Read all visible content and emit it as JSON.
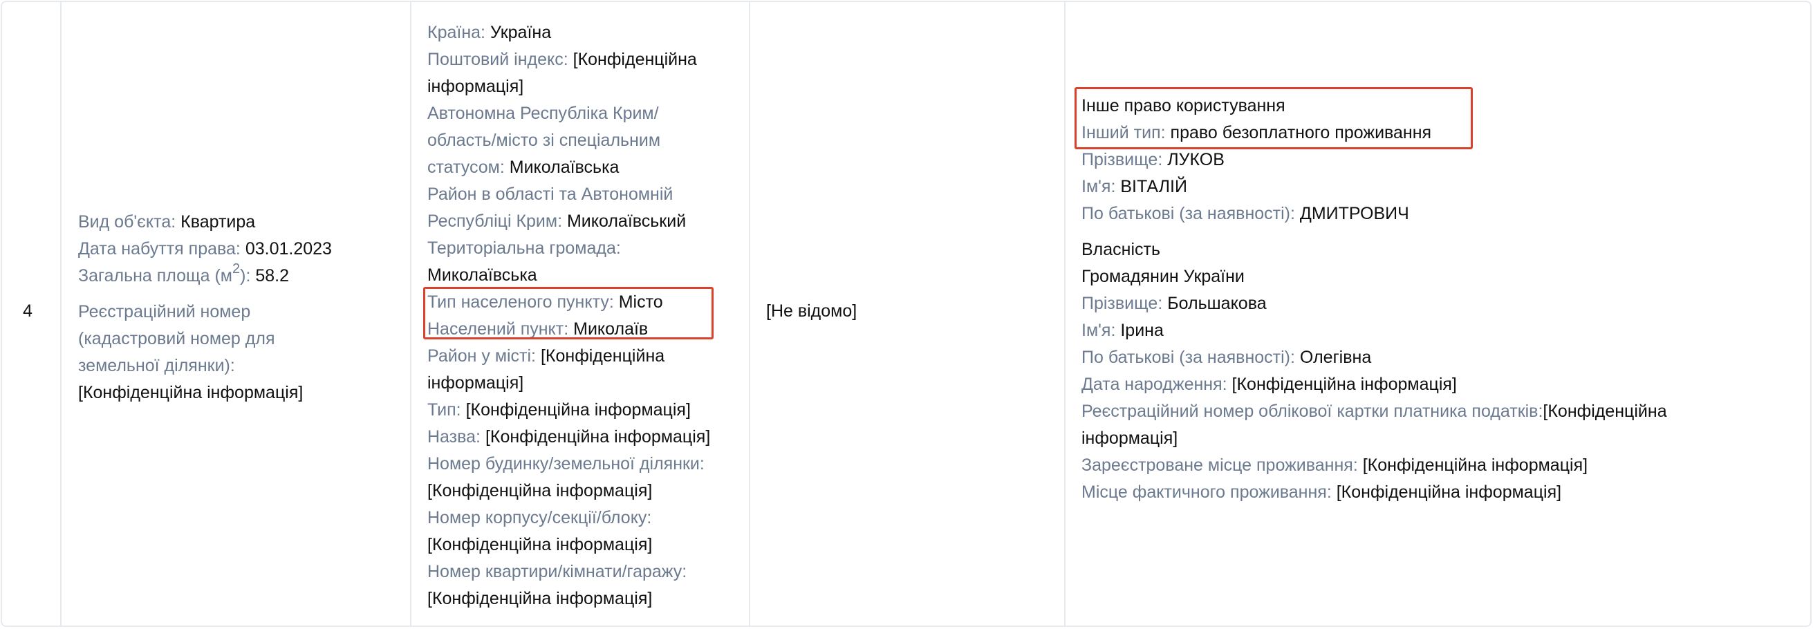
{
  "row": {
    "number": "4",
    "object": {
      "type_label": "Вид об'єкта:",
      "type_value": "Квартира",
      "date_label": "Дата набуття права:",
      "date_value": "03.01.2023",
      "area_label_pre": "Загальна площа (м",
      "area_label_sup": "2",
      "area_label_post": "):",
      "area_value": "58.2",
      "reg_label_line1": "Реєстраційний номер",
      "reg_label_line2": "(кадастровий номер для",
      "reg_label_line3": "земельної ділянки):",
      "reg_value": "[Конфіденційна інформація]"
    },
    "address": {
      "country_label": "Країна:",
      "country_value": "Україна",
      "postal_label": "Поштовий індекс:",
      "postal_value_1": "[Конфіденційна",
      "postal_value_2": "інформація]",
      "region_label_1": "Автономна Республіка Крим/",
      "region_label_2": "область/місто зі спеціальним",
      "region_label_3": "статусом:",
      "region_value": "Миколаївська",
      "district_label_1": "Район в області та Автономній",
      "district_label_2": "Республіці Крим:",
      "district_value": "Миколаївський",
      "community_label": "Територіальна громада:",
      "community_value": "Миколаївська",
      "settlement_type_label": "Тип населеного пункту:",
      "settlement_type_value": "Місто",
      "settlement_label": "Населений пункт:",
      "settlement_value": "Миколаїв",
      "city_district_label": "Район у місті:",
      "city_district_value_1": "[Конфіденційна",
      "city_district_value_2": "інформація]",
      "street_type_label": "Тип:",
      "street_type_value": "[Конфіденційна інформація]",
      "street_name_label": "Назва:",
      "street_name_value": "[Конфіденційна інформація]",
      "house_label": "Номер будинку/земельної ділянки:",
      "house_value": "[Конфіденційна інформація]",
      "building_label": "Номер корпусу/секції/блоку:",
      "building_value": "[Конфіденційна інформація]",
      "apartment_label": "Номер квартири/кімнати/гаражу:",
      "apartment_value": "[Конфіденційна інформація]"
    },
    "unknown": "[Не відомо]",
    "rights": {
      "use_title": "Інше право користування",
      "other_type_label": "Інший тип:",
      "other_type_value": "право безоплатного проживання",
      "surname_label_1": "Прізвище:",
      "surname_value_1": "ЛУКОВ",
      "name_label_1": "Ім'я:",
      "name_value_1": "ВІТАЛІЙ",
      "patronymic_label_1": "По батькові (за наявності):",
      "patronymic_value_1": "ДМИТРОВИЧ",
      "ownership_title": "Власність",
      "citizen": "Громадянин України",
      "surname_label_2": "Прізвище:",
      "surname_value_2": "Большакова",
      "name_label_2": "Ім'я:",
      "name_value_2": "Ірина",
      "patronymic_label_2": "По батькові (за наявності):",
      "patronymic_value_2": "Олегівна",
      "birth_label": "Дата народження:",
      "birth_value": "[Конфіденційна інформація]",
      "tax_label": "Реєстраційний номер облікової картки платника податків:",
      "tax_value_1": "[Конфіденційна",
      "tax_value_2": "інформація]",
      "registered_label": "Зареєстроване місце проживання:",
      "registered_value": "[Конфіденційна інформація]",
      "actual_label": "Місце фактичного проживання:",
      "actual_value": "[Конфіденційна інформація]"
    }
  },
  "colors": {
    "label": "#6c7a90",
    "value": "#111111",
    "border": "#e6e9ee",
    "highlight": "#d9412b"
  }
}
